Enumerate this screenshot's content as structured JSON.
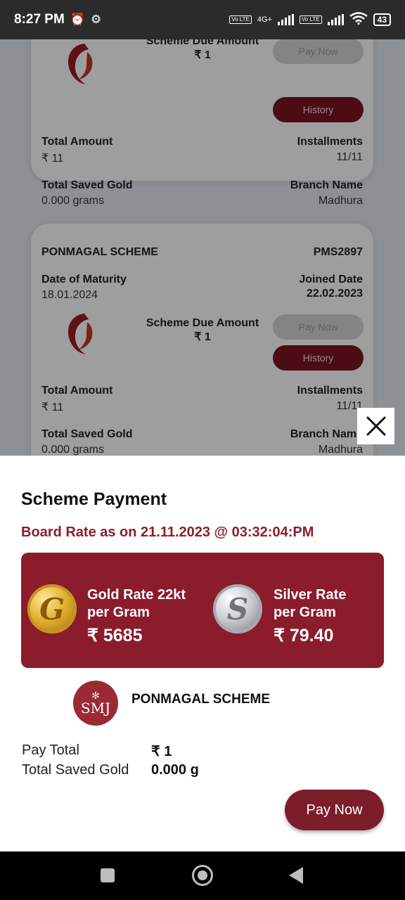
{
  "status_bar": {
    "time": "8:27 PM",
    "alarm_icon": "alarm-clock-icon",
    "settings_icon": "gear-icon",
    "network_1": "4G+",
    "volte_1": "Vo LTE",
    "volte_2": "Vo LTE",
    "battery": "43"
  },
  "background_cards": [
    {
      "scheme_due_label": "Scheme Due Amount",
      "scheme_due_value": "₹ 1",
      "pay_now_label": "Pay Now",
      "history_label": "History",
      "total_amount_label": "Total Amount",
      "total_amount_value": "₹ 11",
      "installments_label": "Installments",
      "installments_value": "11/11",
      "total_saved_gold_label": "Total Saved Gold",
      "total_saved_gold_value": "0.000 grams",
      "branch_name_label": "Branch Name",
      "branch_name_value": "Madhura"
    },
    {
      "scheme_name": "PONMAGAL SCHEME",
      "scheme_code": "PMS2897",
      "maturity_label": "Date of Maturity",
      "maturity_value": "18.01.2024",
      "joined_label": "Joined Date",
      "joined_value": "22.02.2023",
      "scheme_due_label": "Scheme Due Amount",
      "scheme_due_value": "₹ 1",
      "pay_now_label": "Pay Now",
      "history_label": "History",
      "total_amount_label": "Total Amount",
      "total_amount_value": "₹ 11",
      "installments_label": "Installments",
      "installments_value": "11/11",
      "total_saved_gold_label": "Total Saved Gold",
      "total_saved_gold_value": "0.000 grams",
      "branch_name_label": "Branch Name",
      "branch_name_value": "Madhura"
    }
  ],
  "sheet": {
    "title": "Scheme Payment",
    "board_rate": "Board Rate as on 21.11.2023 @ 03:32:04:PM",
    "gold": {
      "coin_letter": "G",
      "line1": "Gold Rate 22kt",
      "line2": "per Gram",
      "price": "₹ 5685"
    },
    "silver": {
      "coin_letter": "S",
      "line1": "Silver Rate",
      "line2": "per Gram",
      "price": "₹ 79.40"
    },
    "logo_text": "SMJ",
    "scheme_name": "PONMAGAL SCHEME",
    "pay_total_label": "Pay Total",
    "pay_total_value": "₹ 1",
    "saved_gold_label": "Total Saved Gold",
    "saved_gold_value": "0.000 g",
    "pay_button": "Pay Now"
  },
  "colors": {
    "brand_maroon": "#8b1c2b",
    "button_maroon": "#7c1d2b",
    "board_rate_text": "#8a1f2c"
  }
}
